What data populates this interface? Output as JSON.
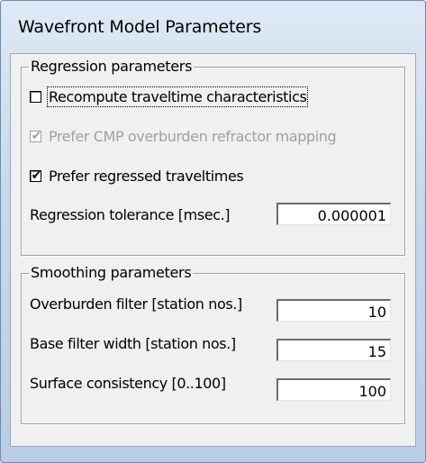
{
  "window": {
    "title": "Wavefront Model Parameters"
  },
  "regression": {
    "group_title": "Regression parameters",
    "recompute": {
      "label": "Recompute traveltime characteristics",
      "checked": false
    },
    "prefer_cmp": {
      "label": "Prefer CMP overburden refractor mapping",
      "checked": true,
      "disabled": true
    },
    "prefer_regressed": {
      "label": "Prefer regressed traveltimes",
      "checked": true
    },
    "tolerance": {
      "label": "Regression tolerance [msec.]",
      "value": "0.000001"
    }
  },
  "smoothing": {
    "group_title": "Smoothing parameters",
    "overburden": {
      "label": "Overburden filter [station nos.]",
      "value": "10"
    },
    "base_filter": {
      "label": "Base filter width [station nos.]",
      "value": "15"
    },
    "surface": {
      "label": "Surface consistency [0..100]",
      "value": "100"
    }
  }
}
